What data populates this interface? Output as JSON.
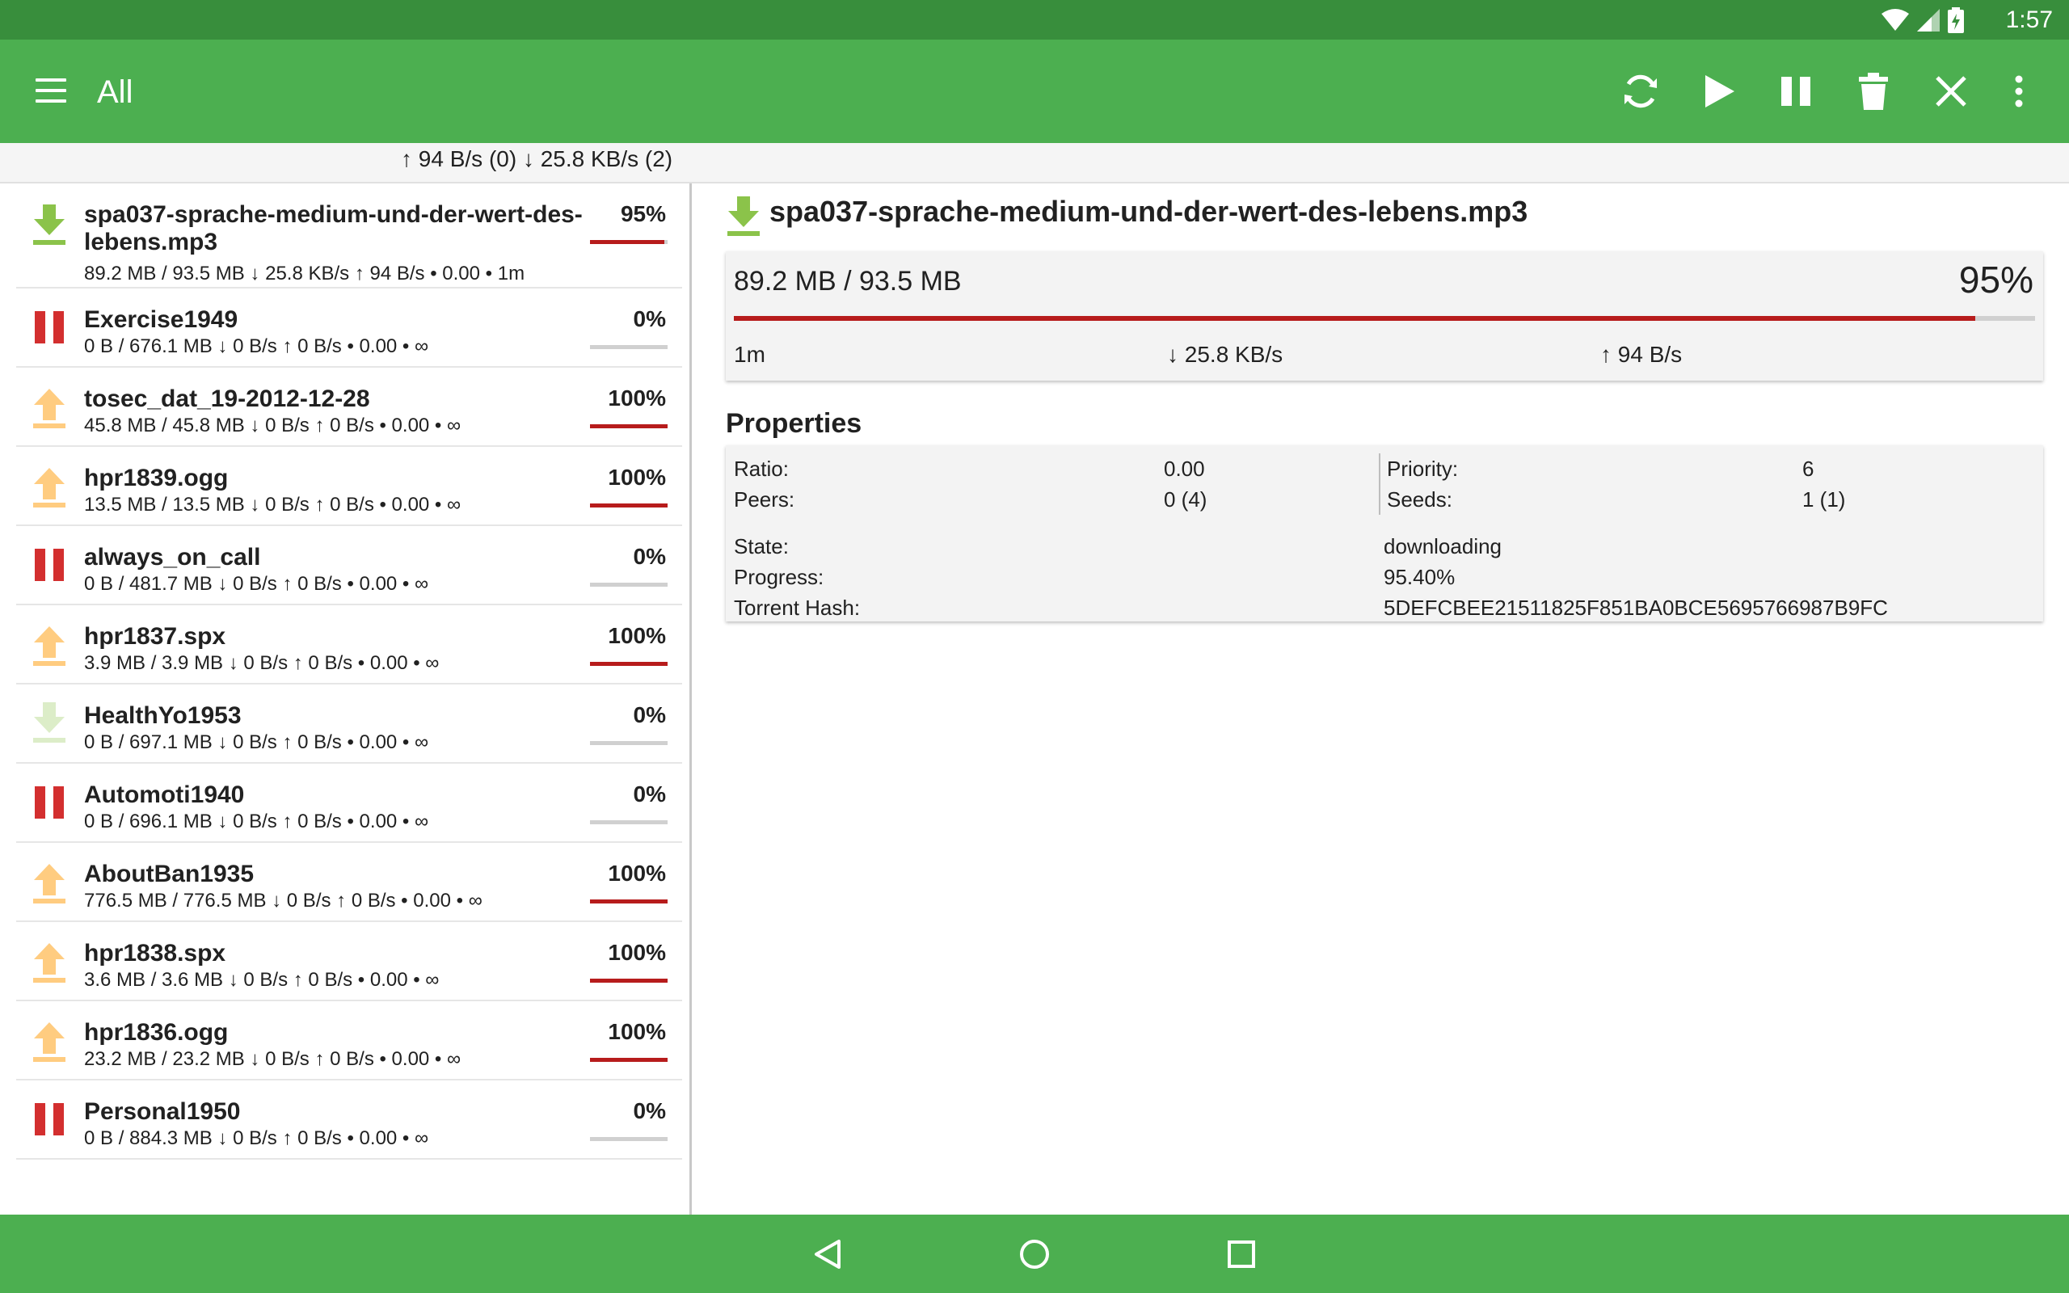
{
  "status_bar": {
    "time": "1:57"
  },
  "app_bar": {
    "title": "All",
    "actions": [
      "refresh-icon",
      "play-icon",
      "pause-icon",
      "trash-icon",
      "close-icon",
      "more-vert-icon"
    ]
  },
  "speed_bar": {
    "text": "↑ 94 B/s (0) ↓ 25.8 KB/s (2)"
  },
  "colors": {
    "status_bar": "#388e3c",
    "app_bar": "#4caf50",
    "progress": "#b71c1c",
    "paused": "#d32f2f",
    "seeding": "#ffcc80",
    "downloading": "#8bc34a",
    "queued": "#dcedc8"
  },
  "torrents": [
    {
      "name": "spa037-sprache-medium-und-der-wert-des-lebens.mp3",
      "info": "89.2 MB / 93.5 MB ↓ 25.8 KB/s ↑ 94 B/s • 0.00 • 1m",
      "percent": "95%",
      "progress": 0.954,
      "state": "downloading"
    },
    {
      "name": "Exercise1949",
      "info": "0 B / 676.1 MB ↓ 0 B/s ↑ 0 B/s • 0.00 • ∞",
      "percent": "0%",
      "progress": 0,
      "state": "paused"
    },
    {
      "name": "tosec_dat_19-2012-12-28",
      "info": "45.8 MB / 45.8 MB ↓ 0 B/s ↑ 0 B/s • 0.00 • ∞",
      "percent": "100%",
      "progress": 1,
      "state": "seeding"
    },
    {
      "name": "hpr1839.ogg",
      "info": "13.5 MB / 13.5 MB ↓ 0 B/s ↑ 0 B/s • 0.00 • ∞",
      "percent": "100%",
      "progress": 1,
      "state": "seeding"
    },
    {
      "name": "always_on_call",
      "info": "0 B / 481.7 MB ↓ 0 B/s ↑ 0 B/s • 0.00 • ∞",
      "percent": "0%",
      "progress": 0,
      "state": "paused"
    },
    {
      "name": "hpr1837.spx",
      "info": "3.9 MB / 3.9 MB ↓ 0 B/s ↑ 0 B/s • 0.00 • ∞",
      "percent": "100%",
      "progress": 1,
      "state": "seeding"
    },
    {
      "name": "HealthYo1953",
      "info": "0 B / 697.1 MB ↓ 0 B/s ↑ 0 B/s • 0.00 • ∞",
      "percent": "0%",
      "progress": 0,
      "state": "queued"
    },
    {
      "name": "Automoti1940",
      "info": "0 B / 696.1 MB ↓ 0 B/s ↑ 0 B/s • 0.00 • ∞",
      "percent": "0%",
      "progress": 0,
      "state": "paused"
    },
    {
      "name": "AboutBan1935",
      "info": "776.5 MB / 776.5 MB ↓ 0 B/s ↑ 0 B/s • 0.00 • ∞",
      "percent": "100%",
      "progress": 1,
      "state": "seeding"
    },
    {
      "name": "hpr1838.spx",
      "info": "3.6 MB / 3.6 MB ↓ 0 B/s ↑ 0 B/s • 0.00 • ∞",
      "percent": "100%",
      "progress": 1,
      "state": "seeding"
    },
    {
      "name": "hpr1836.ogg",
      "info": "23.2 MB / 23.2 MB ↓ 0 B/s ↑ 0 B/s • 0.00 • ∞",
      "percent": "100%",
      "progress": 1,
      "state": "seeding"
    },
    {
      "name": "Personal1950",
      "info": "0 B / 884.3 MB ↓ 0 B/s ↑ 0 B/s • 0.00 • ∞",
      "percent": "0%",
      "progress": 0,
      "state": "paused"
    }
  ],
  "detail": {
    "title": "spa037-sprache-medium-und-der-wert-des-lebens.mp3",
    "size": "89.2 MB / 93.5 MB",
    "percent": "95%",
    "progress": 0.954,
    "eta": "1m",
    "download_speed": "↓ 25.8 KB/s",
    "upload_speed": "↑ 94 B/s",
    "properties_title": "Properties",
    "properties": {
      "ratio_label": "Ratio:",
      "ratio": "0.00",
      "priority_label": "Priority:",
      "priority": "6",
      "peers_label": "Peers:",
      "peers": "0 (4)",
      "seeds_label": "Seeds:",
      "seeds": "1 (1)",
      "state_label": "State:",
      "state": "downloading",
      "progress_label": "Progress:",
      "progress": "95.40%",
      "hash_label": "Torrent Hash:",
      "hash": "5DEFCBEE21511825F851BA0BCE5695766987B9FC"
    }
  },
  "nav_bar": [
    "back-icon",
    "home-icon",
    "recents-icon"
  ]
}
